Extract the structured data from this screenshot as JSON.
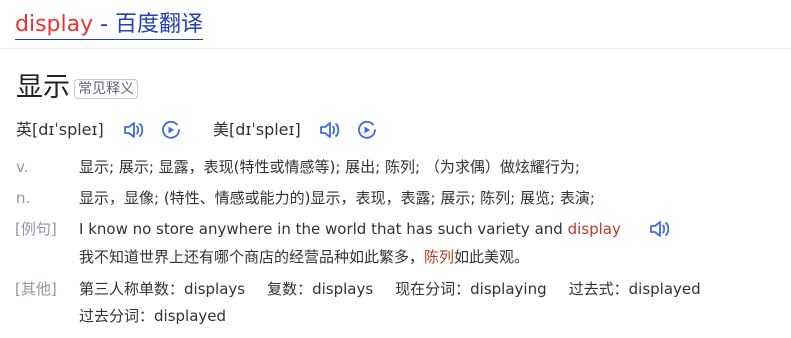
{
  "header": {
    "keyword": "display",
    "suffix": " - 百度翻译"
  },
  "entry": {
    "word": "显示",
    "badge": "常见释义",
    "pron_uk_label": "英[dɪˈspleɪ]",
    "pron_us_label": "美[dɪˈspleɪ]"
  },
  "senses": [
    {
      "pos": "v.",
      "text": "显示; 展示; 显露，表现(特性或情感等); 展出; 陈列; （为求偶）做炫耀行为;"
    },
    {
      "pos": "n.",
      "text": "显示，显像; (特性、情感或能力的)显示，表现，表露; 展示; 陈列; 展览; 表演;"
    }
  ],
  "example": {
    "tag": "[例句]",
    "en_prefix": "I know no store anywhere in the world that has such variety and ",
    "en_highlight": "display",
    "zh_prefix": "我不知道世界上还有哪个商店的经营品种如此繁多，",
    "zh_highlight": "陈列",
    "zh_suffix": "如此美观。"
  },
  "forms": {
    "tag": "[其他]",
    "third_person": "第三人称单数：displays",
    "plural": "复数：displays",
    "present_participle": "现在分词：displaying",
    "past": "过去式：displayed",
    "past_participle": "过去分词：displayed"
  },
  "colors": {
    "link": "#2440b3",
    "keyword": "#e33333",
    "icon": "#3f6ce0",
    "muted": "#9195a3"
  },
  "icons": [
    "speaker-icon",
    "slow-play-icon"
  ]
}
